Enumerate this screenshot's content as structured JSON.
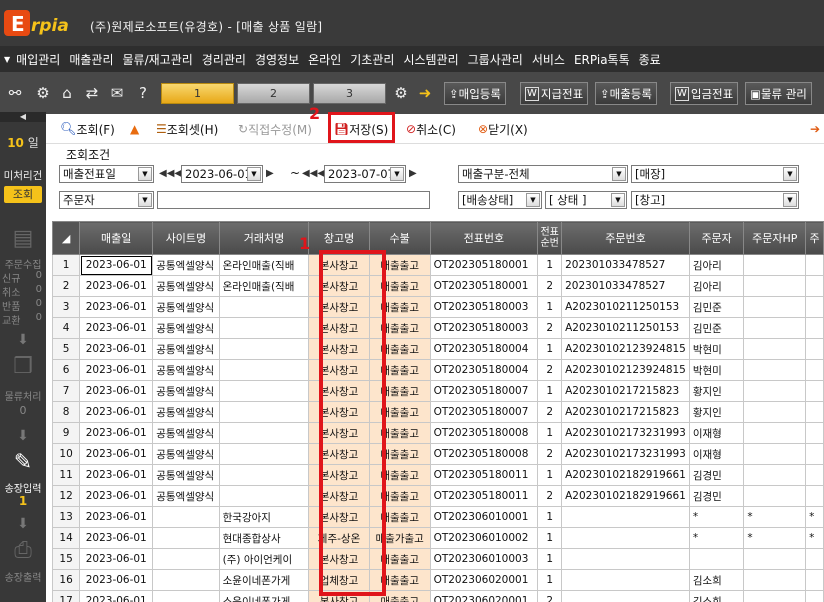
{
  "window": {
    "logo_text": "Erpia",
    "title": "(주)원제로소프트(유경호) - [매출 상품 일람]"
  },
  "menu": [
    "매입관리",
    "매출관리",
    "물류/재고관리",
    "경리관리",
    "경영정보",
    "온라인",
    "기초관리",
    "시스템관리",
    "그룹사관리",
    "서비스",
    "ERPia톡톡",
    "종료"
  ],
  "toolbar": {
    "page_tabs": [
      "1",
      "2",
      "3"
    ],
    "buttons": [
      {
        "icon": "",
        "label": "매입등록"
      },
      {
        "icon": "W",
        "label": "지급전표"
      },
      {
        "icon": "",
        "label": "매출등록"
      },
      {
        "icon": "W",
        "label": "입금전표"
      },
      {
        "icon": "",
        "label": "물류 관리"
      }
    ]
  },
  "sidebar": {
    "day_count": "10",
    "day_unit": "일",
    "unprocessed_label": "미처리건",
    "query_button": "조회",
    "order_collect": "주문수집",
    "order_stats": [
      {
        "label": "신규",
        "value": "0"
      },
      {
        "label": "취소",
        "value": "0"
      },
      {
        "label": "반품",
        "value": "0"
      },
      {
        "label": "교환",
        "value": "0"
      }
    ],
    "logistics": "물류처리",
    "logistics_count": "0",
    "invoice_input": "송장입력",
    "invoice_count": "1",
    "invoice_print": "송장출력"
  },
  "actions": {
    "search": "조회(F)",
    "search_set": "조회셋(H)",
    "direct_edit": "직접수정(M)",
    "save": "저장(S)",
    "cancel": "취소(C)",
    "close": "닫기(X)"
  },
  "filters": {
    "group_label": "조회조건",
    "date_type": "매출전표일",
    "date_from": "2023-06-01",
    "date_sep": "~",
    "date_to": "2023-07-07",
    "sales_type": "매출구분-전체",
    "store": "[매장]",
    "orderer": "주문자",
    "delivery_status": "[배송상태]",
    "status": "[ 상태 ]",
    "warehouse": "[창고]"
  },
  "annotations": [
    "1",
    "2"
  ],
  "grid": {
    "headers": [
      "매출일",
      "사이트명",
      "거래처명",
      "창고명",
      "수불",
      "전표번호",
      "전표순번",
      "주문번호",
      "주문자",
      "주문자HP",
      "주"
    ],
    "rows": [
      {
        "n": "1",
        "date": "2023-06-01",
        "site": "공통엑셀양식",
        "client": "온라인매출(직배",
        "wh": "본사창고",
        "sb": "매출출고",
        "slip": "OT202305180001",
        "seq": "1",
        "order": "202301033478527",
        "orderer": "김아리",
        "hp": "",
        "ext": ""
      },
      {
        "n": "2",
        "date": "2023-06-01",
        "site": "공통엑셀양식",
        "client": "온라인매출(직배",
        "wh": "본사창고",
        "sb": "매출출고",
        "slip": "OT202305180001",
        "seq": "2",
        "order": "202301033478527",
        "orderer": "김아리",
        "hp": "",
        "ext": ""
      },
      {
        "n": "3",
        "date": "2023-06-01",
        "site": "공통엑셀양식",
        "client": "",
        "wh": "본사창고",
        "sb": "매출출고",
        "slip": "OT202305180003",
        "seq": "1",
        "order": "A2023010211250153",
        "orderer": "김민준",
        "hp": "",
        "ext": ""
      },
      {
        "n": "4",
        "date": "2023-06-01",
        "site": "공통엑셀양식",
        "client": "",
        "wh": "본사창고",
        "sb": "매출출고",
        "slip": "OT202305180003",
        "seq": "2",
        "order": "A2023010211250153",
        "orderer": "김민준",
        "hp": "",
        "ext": ""
      },
      {
        "n": "5",
        "date": "2023-06-01",
        "site": "공통엑셀양식",
        "client": "",
        "wh": "본사창고",
        "sb": "매출출고",
        "slip": "OT202305180004",
        "seq": "1",
        "order": "A20230102123924815",
        "orderer": "박현미",
        "hp": "",
        "ext": ""
      },
      {
        "n": "6",
        "date": "2023-06-01",
        "site": "공통엑셀양식",
        "client": "",
        "wh": "본사창고",
        "sb": "매출출고",
        "slip": "OT202305180004",
        "seq": "2",
        "order": "A20230102123924815",
        "orderer": "박현미",
        "hp": "",
        "ext": ""
      },
      {
        "n": "7",
        "date": "2023-06-01",
        "site": "공통엑셀양식",
        "client": "",
        "wh": "본사창고",
        "sb": "매출출고",
        "slip": "OT202305180007",
        "seq": "1",
        "order": "A2023010217215823",
        "orderer": "황지인",
        "hp": "",
        "ext": ""
      },
      {
        "n": "8",
        "date": "2023-06-01",
        "site": "공통엑셀양식",
        "client": "",
        "wh": "본사창고",
        "sb": "매출출고",
        "slip": "OT202305180007",
        "seq": "2",
        "order": "A2023010217215823",
        "orderer": "황지인",
        "hp": "",
        "ext": ""
      },
      {
        "n": "9",
        "date": "2023-06-01",
        "site": "공통엑셀양식",
        "client": "",
        "wh": "본사창고",
        "sb": "매출출고",
        "slip": "OT202305180008",
        "seq": "1",
        "order": "A20230102173231993",
        "orderer": "이재형",
        "hp": "",
        "ext": ""
      },
      {
        "n": "10",
        "date": "2023-06-01",
        "site": "공통엑셀양식",
        "client": "",
        "wh": "본사창고",
        "sb": "매출출고",
        "slip": "OT202305180008",
        "seq": "2",
        "order": "A20230102173231993",
        "orderer": "이재형",
        "hp": "",
        "ext": ""
      },
      {
        "n": "11",
        "date": "2023-06-01",
        "site": "공통엑셀양식",
        "client": "",
        "wh": "본사창고",
        "sb": "매출출고",
        "slip": "OT202305180011",
        "seq": "1",
        "order": "A20230102182919661",
        "orderer": "김경민",
        "hp": "",
        "ext": ""
      },
      {
        "n": "12",
        "date": "2023-06-01",
        "site": "공통엑셀양식",
        "client": "",
        "wh": "본사창고",
        "sb": "매출출고",
        "slip": "OT202305180011",
        "seq": "2",
        "order": "A20230102182919661",
        "orderer": "김경민",
        "hp": "",
        "ext": ""
      },
      {
        "n": "13",
        "date": "2023-06-01",
        "site": "",
        "client": "한국강아지",
        "wh": "본사창고",
        "sb": "매출출고",
        "slip": "OT202306010001",
        "seq": "1",
        "order": "",
        "orderer": "*",
        "hp": "*",
        "ext": "*"
      },
      {
        "n": "14",
        "date": "2023-06-01",
        "site": "",
        "client": "현대종합상사",
        "wh": "제주-상온",
        "sb": "매출가출고",
        "slip": "OT202306010002",
        "seq": "1",
        "order": "",
        "orderer": "*",
        "hp": "*",
        "ext": "*"
      },
      {
        "n": "15",
        "date": "2023-06-01",
        "site": "",
        "client": "(주) 아이언케이",
        "wh": "본사창고",
        "sb": "매출출고",
        "slip": "OT202306010003",
        "seq": "1",
        "order": "",
        "orderer": "",
        "hp": "",
        "ext": ""
      },
      {
        "n": "16",
        "date": "2023-06-01",
        "site": "",
        "client": "소윤이네폰가게",
        "wh": "업체창고",
        "sb": "매출출고",
        "slip": "OT202306020001",
        "seq": "1",
        "order": "",
        "orderer": "김소희",
        "hp": "",
        "ext": ""
      },
      {
        "n": "17",
        "date": "2023-06-01",
        "site": "",
        "client": "소윤이네폰가게",
        "wh": "본사창고",
        "sb": "매출출고",
        "slip": "OT202306020001",
        "seq": "2",
        "order": "",
        "orderer": "김소희",
        "hp": "",
        "ext": ""
      }
    ]
  }
}
